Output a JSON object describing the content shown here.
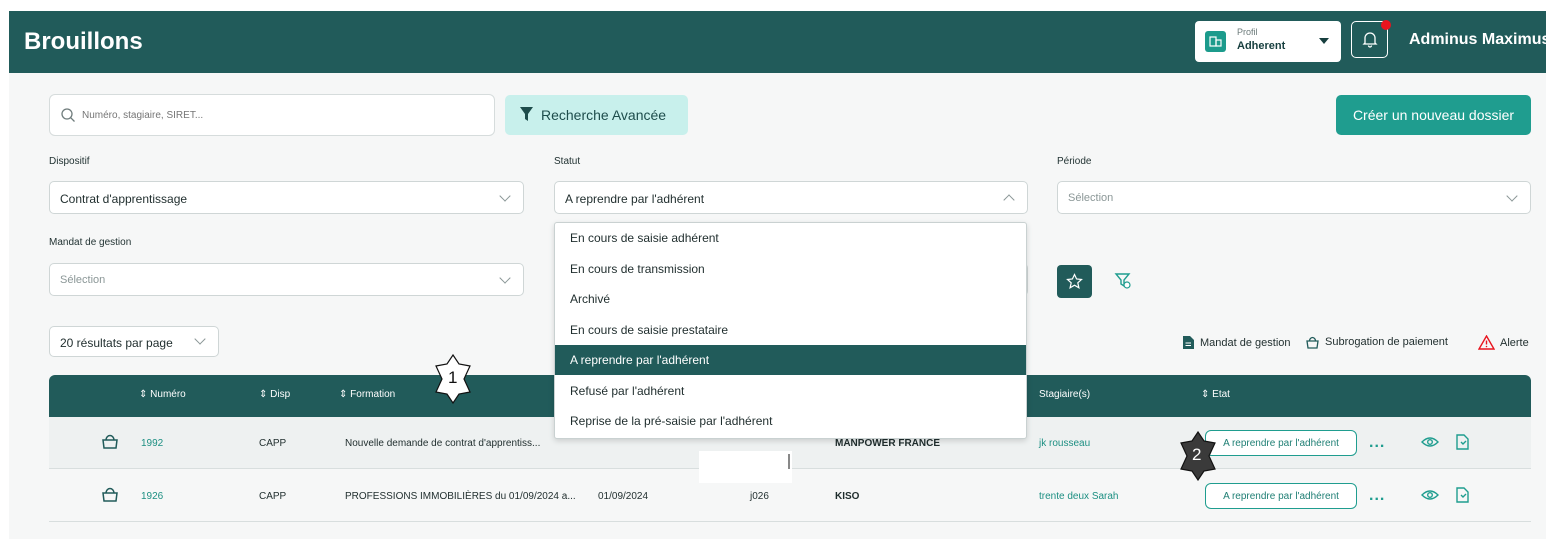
{
  "header": {
    "title": "Brouillons",
    "profile_caption": "Profil",
    "profile_value": "Adherent",
    "user_name": "Adminus Maximus"
  },
  "toolbar": {
    "search_placeholder": "Numéro, stagiaire, SIRET...",
    "advanced_search_label": "Recherche Avancée",
    "create_label": "Créer un nouveau dossier"
  },
  "filters": {
    "dispositif": {
      "label": "Dispositif",
      "value": "Contrat d'apprentissage"
    },
    "statut": {
      "label": "Statut",
      "value": "A reprendre par l'adhérent"
    },
    "periode": {
      "label": "Période",
      "value": "Sélection"
    },
    "mandat": {
      "label": "Mandat de gestion",
      "value": "Sélection"
    }
  },
  "statut_options": [
    "En cours de saisie adhérent",
    "En cours de transmission",
    "Archivé",
    "En cours de saisie prestataire",
    "A reprendre par l'adhérent",
    "Refusé par l'adhérent",
    "Reprise de la pré-saisie par l'adhérent"
  ],
  "statut_selected_index": 4,
  "pagination": {
    "per_page_label": "20 résultats par page"
  },
  "legend": {
    "mandat": "Mandat de gestion",
    "subrogation": "Subrogation de paiement",
    "alerte": "Alerte"
  },
  "table": {
    "headers": {
      "numero": "Numéro",
      "disp": "Disp",
      "formation": "Formation",
      "stagiaires": "Stagiaire(s)",
      "etat": "Etat"
    },
    "rows": [
      {
        "numero": "1992",
        "disp": "CAPP",
        "formation": "Nouvelle demande de contrat d'apprentiss...",
        "start": "",
        "end": "",
        "employeur": "MANPOWER FRANCE",
        "stagiaire": "jk rousseau",
        "etat": "A reprendre par l'adhérent"
      },
      {
        "numero": "1926",
        "disp": "CAPP",
        "formation": "PROFESSIONS IMMOBILIÈRES du 01/09/2024 a...",
        "start": "01/09/2024",
        "end": "j026",
        "employeur": "KISO",
        "stagiaire": "trente deux Sarah",
        "etat": "A reprendre par l'adhérent"
      }
    ]
  },
  "markers": {
    "m1": "1",
    "m2": "2"
  },
  "colors": {
    "primary": "#215b5a",
    "accent": "#1f9d8f",
    "alert": "#e8141e"
  }
}
